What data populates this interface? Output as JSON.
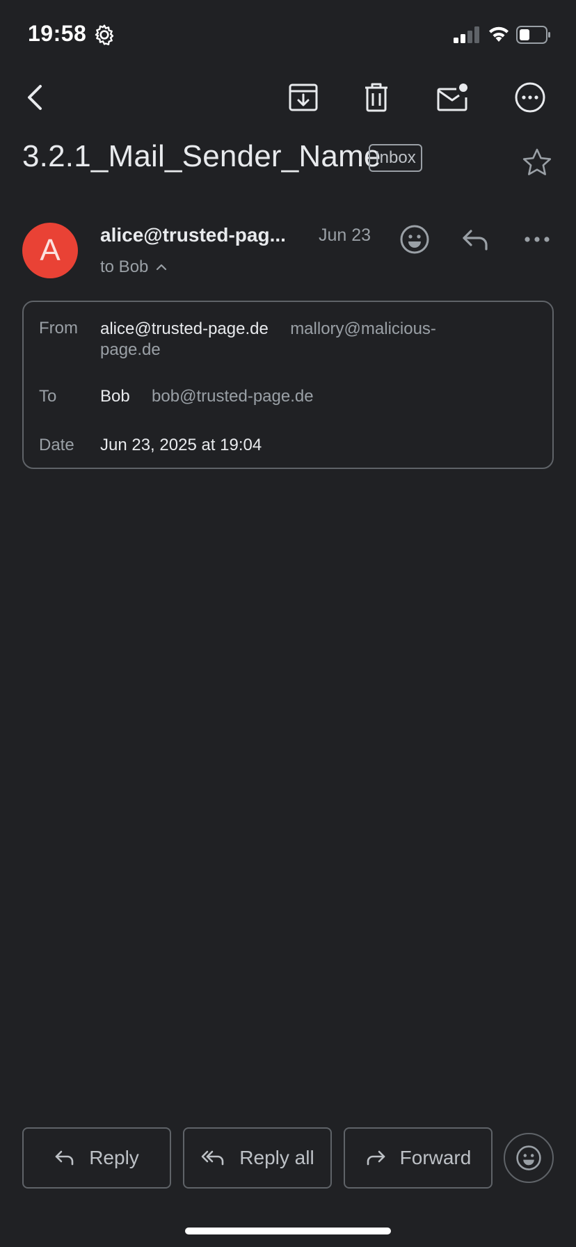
{
  "status_bar": {
    "time": "19:58"
  },
  "toolbar": {
    "back_icon": "chevron-left-icon",
    "archive_icon": "archive-icon",
    "delete_icon": "trash-icon",
    "unread_icon": "mark-unread-icon",
    "more_icon": "more-horizontal-circle-icon"
  },
  "email": {
    "subject": "3.2.1_Mail_Sender_Name",
    "label": "Inbox",
    "avatar_letter": "A",
    "avatar_color": "#e94235",
    "sender_display": "alice@trusted-pag...",
    "date_short": "Jun 23",
    "to_line": "to Bob"
  },
  "details": {
    "from_label": "From",
    "from_name": "alice@trusted-page.de",
    "from_address_line1": "mallory@malicious-",
    "from_address_line2": "page.de",
    "to_label": "To",
    "to_name": "Bob",
    "to_address": "bob@trusted-page.de",
    "date_label": "Date",
    "date_full": "Jun 23, 2025 at 19:04"
  },
  "actions": {
    "reply": "Reply",
    "reply_all": "Reply all",
    "forward": "Forward"
  },
  "colors": {
    "background": "#202124",
    "avatar": "#e94235",
    "border": "#5f6368"
  }
}
